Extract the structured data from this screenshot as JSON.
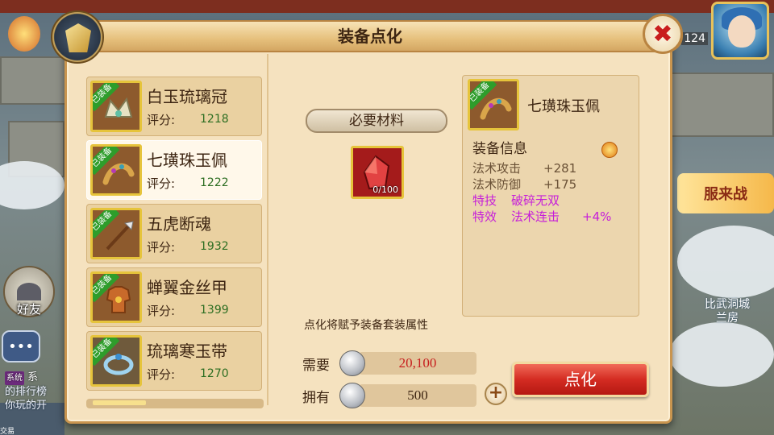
{
  "dialog": {
    "title": "装备点化",
    "close_label": "✖"
  },
  "equipment_list": [
    {
      "name": "白玉琉璃冠",
      "tag": "已装备",
      "score_label": "评分:",
      "score": "1218",
      "icon": "crown-icon",
      "selected": false
    },
    {
      "name": "七璜珠玉佩",
      "tag": "已装备",
      "score_label": "评分:",
      "score": "1222",
      "icon": "jade-pendant-icon",
      "selected": true
    },
    {
      "name": "五虎断魂",
      "tag": "已装备",
      "score_label": "评分:",
      "score": "1932",
      "icon": "spear-icon",
      "selected": false
    },
    {
      "name": "蝉翼金丝甲",
      "tag": "已装备",
      "score_label": "评分:",
      "score": "1399",
      "icon": "armor-icon",
      "selected": false
    },
    {
      "name": "琉璃寒玉带",
      "tag": "已装备",
      "score_label": "评分:",
      "score": "1270",
      "icon": "belt-icon",
      "selected": false
    }
  ],
  "materials": {
    "banner_label": "必要材料",
    "item_icon": "red-gem-icon",
    "count": "0/100"
  },
  "note": "点化将赋予装备套装属性",
  "cost": {
    "need_label": "需要",
    "need_value": "20,100",
    "have_label": "拥有",
    "have_value": "500",
    "plus_label": "+",
    "coin_icon": "silver-coin-icon"
  },
  "detail": {
    "tag": "已装备",
    "name": "七璜珠玉佩",
    "section_title": "装备信息",
    "attributes": [
      {
        "key": "法术攻击",
        "value": "+281",
        "type": "base"
      },
      {
        "key": "法术防御",
        "value": "+175",
        "type": "base"
      },
      {
        "key": "特技",
        "value": "破碎无双",
        "type": "special"
      },
      {
        "key": "特效",
        "value": "法术连击",
        "extra": "+4%",
        "type": "special"
      }
    ]
  },
  "refine_button": "点化",
  "hud": {
    "friend_label": "好友",
    "level": "124",
    "chat_tag": "系统",
    "chat_line1": "系",
    "chat_line2": "的排行榜",
    "chat_line3": "你玩的开",
    "right_banner": "服来战",
    "city_label": "比武洞城\n兰房",
    "bottom_label": "交易"
  },
  "colors": {
    "score_green": "#2d6e22",
    "special_purple": "#c61ed9",
    "need_red": "#c71e1e",
    "button_red": "#d42c22",
    "equipped_green": "#2e9d2b"
  }
}
